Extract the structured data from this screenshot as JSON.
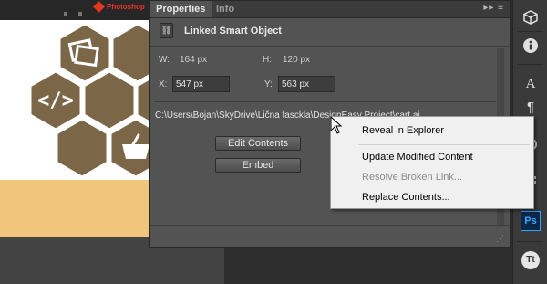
{
  "document": {
    "logo_text": "Photoshop"
  },
  "panel": {
    "tabs": [
      {
        "label": "Properties"
      },
      {
        "label": "Info"
      }
    ],
    "header_title": "Linked Smart Object",
    "width_label": "W:",
    "width_value": "164 px",
    "height_label": "H:",
    "height_value": "120 px",
    "x_label": "X:",
    "x_value": "547 px",
    "y_label": "Y:",
    "y_value": "563 px",
    "file_path": "C:\\Users\\Bojan\\SkyDrive\\Lična fasckla\\DesignEasy Project\\cart.ai",
    "buttons": {
      "edit_contents": "Edit Contents",
      "embed": "Embed"
    }
  },
  "toolbar": {
    "ps_label": "Ps",
    "char_label": "A",
    "info_label": "i",
    "tt_label": "Tt"
  },
  "context_menu": {
    "items": [
      {
        "label": "Reveal in Explorer",
        "enabled": true
      },
      {
        "label": "Update Modified Content",
        "enabled": true
      },
      {
        "label": "Resolve Broken Link...",
        "enabled": false
      },
      {
        "label": "Replace Contents...",
        "enabled": true
      }
    ]
  },
  "colors": {
    "hex_brown": "#7b6647",
    "band_yellow": "#f0c67c",
    "panel_bg": "#535353"
  }
}
